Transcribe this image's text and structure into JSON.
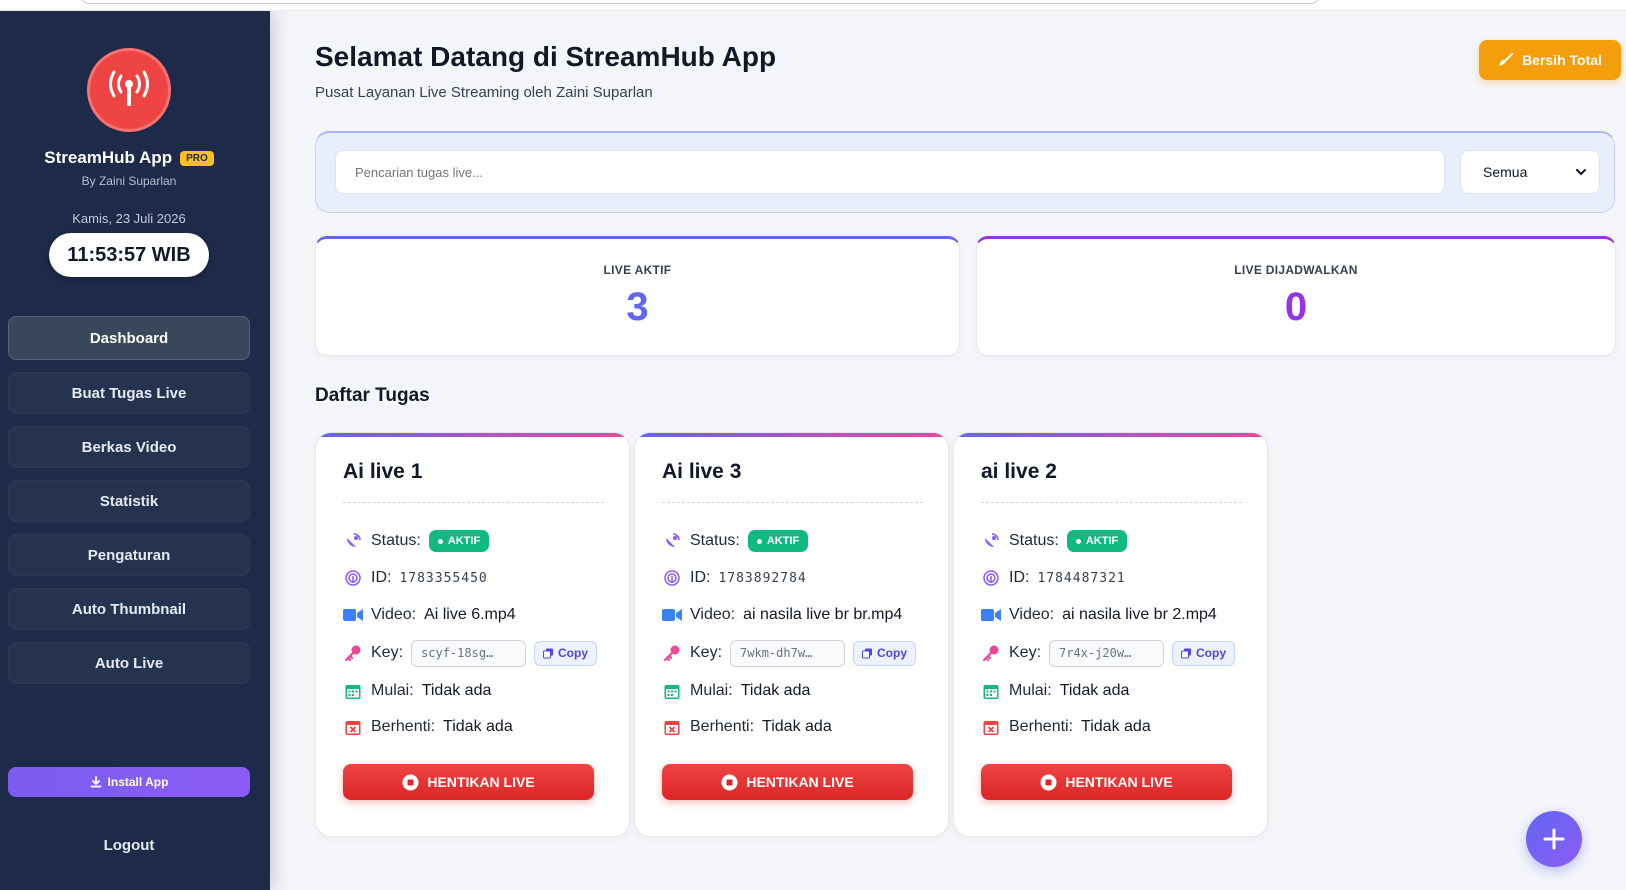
{
  "sidebar": {
    "brand_name": "StreamHub App",
    "pro_badge": "PRO",
    "brand_by": "By Zaini Suparlan",
    "date": "Kamis, 23 Juli 2026",
    "clock": "11:53:57 WIB",
    "items": [
      {
        "label": "Dashboard",
        "active": true
      },
      {
        "label": "Buat Tugas Live"
      },
      {
        "label": "Berkas Video"
      },
      {
        "label": "Statistik"
      },
      {
        "label": "Pengaturan"
      },
      {
        "label": "Auto Thumbnail"
      },
      {
        "label": "Auto Live"
      }
    ],
    "install_label": "Install App",
    "logout_label": "Logout"
  },
  "header": {
    "title": "Selamat Datang di StreamHub App",
    "subtitle": "Pusat Layanan Live Streaming oleh Zaini Suparlan",
    "clear_label": "Bersih Total"
  },
  "search": {
    "placeholder": "Pencarian tugas live...",
    "filter_value": "Semua"
  },
  "stats": {
    "active_label": "LIVE AKTIF",
    "active_value": "3",
    "scheduled_label": "LIVE DIJADWALKAN",
    "scheduled_value": "0"
  },
  "tasks_title": "Daftar Tugas",
  "labels": {
    "status": "Status:",
    "id": "ID:",
    "video": "Video:",
    "key": "Key:",
    "start": "Mulai:",
    "stop": "Berhenti:",
    "copy": "Copy",
    "stop_button": "HENTIKAN LIVE"
  },
  "tasks": [
    {
      "title": "Ai live 1",
      "status": "AKTIF",
      "id": "1783355450",
      "video": "Ai live 6.mp4",
      "key": "scyf-18sg…",
      "start": "Tidak ada",
      "stop": "Tidak ada"
    },
    {
      "title": "Ai live 3",
      "status": "AKTIF",
      "id": "1783892784",
      "video": "ai nasila live br br.mp4",
      "key": "7wkm-dh7w…",
      "start": "Tidak ada",
      "stop": "Tidak ada"
    },
    {
      "title": "ai live 2",
      "status": "AKTIF",
      "id": "1784487321",
      "video": "ai nasila live br 2.mp4",
      "key": "7r4x-j20w…",
      "start": "Tidak ada",
      "stop": "Tidak ada"
    }
  ],
  "colors": {
    "sidebar_bg": "#1e2a4a",
    "accent_blue": "#6366f1",
    "accent_purple": "#9333ea",
    "status_active": "#10b981",
    "danger": "#dc2626",
    "warning": "#f59e0b"
  }
}
